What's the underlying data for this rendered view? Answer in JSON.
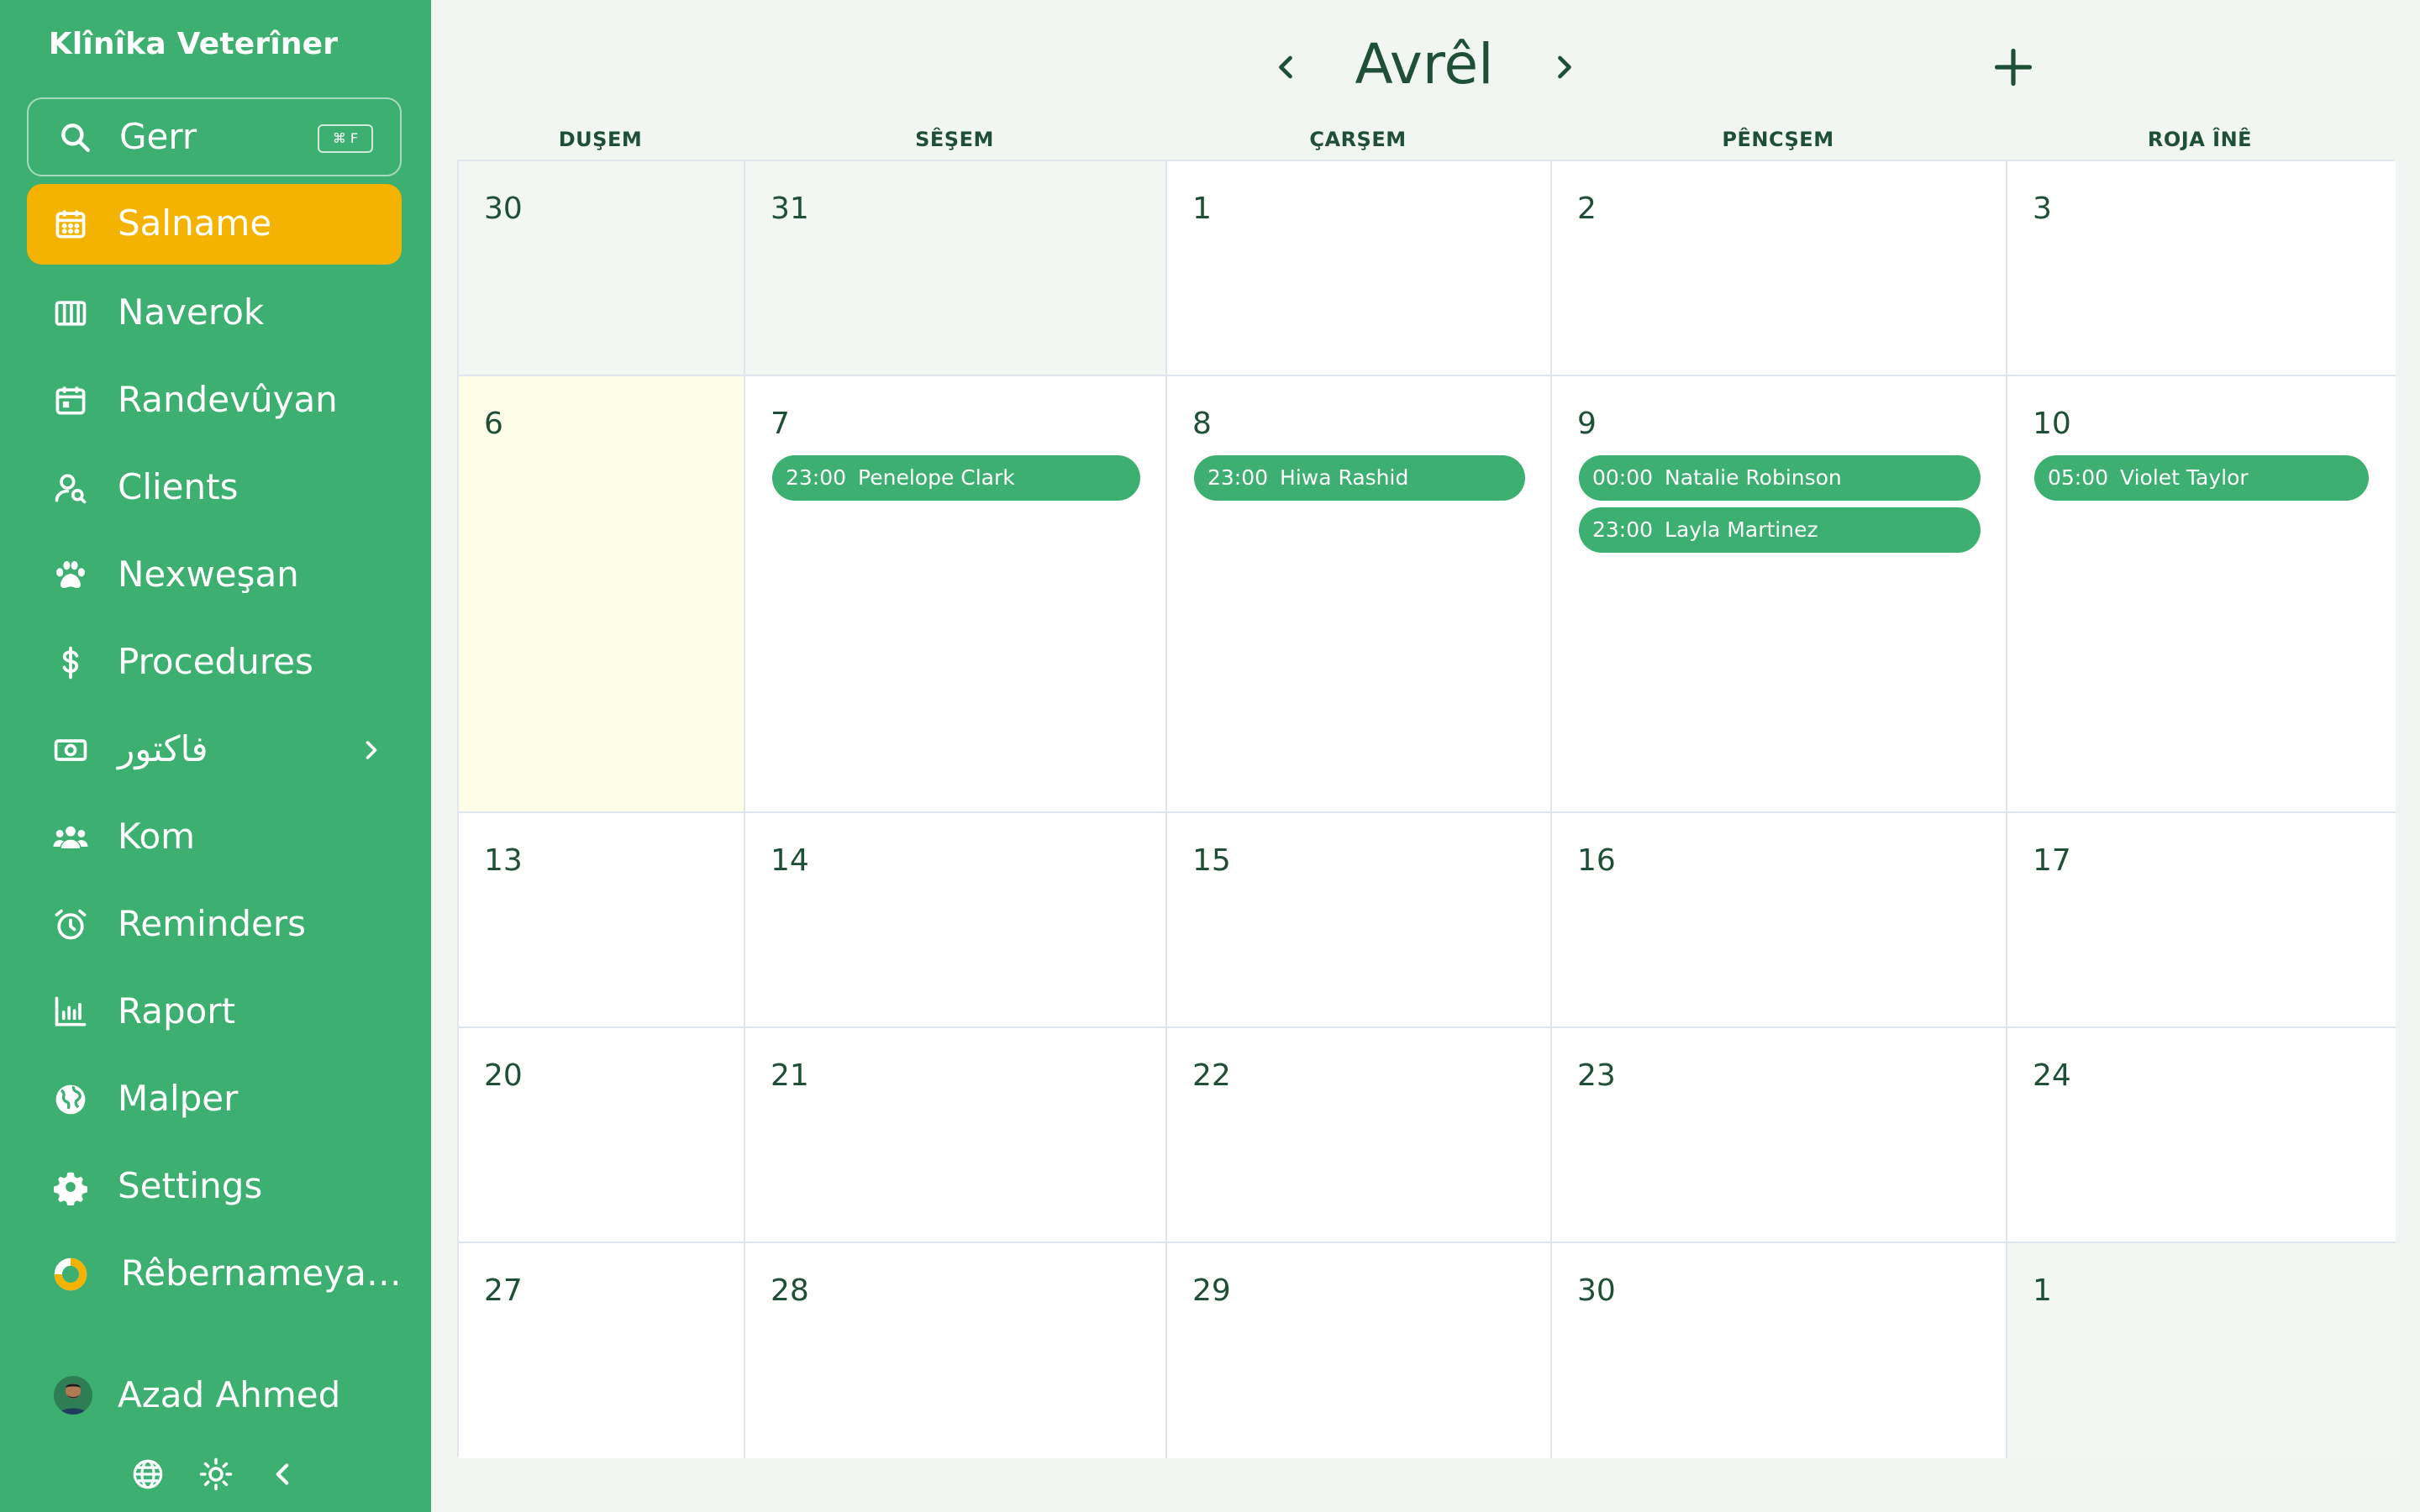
{
  "app": {
    "title": "Klînîka Veterîner"
  },
  "search": {
    "label": "Gerr",
    "shortcut": "⌘ F"
  },
  "nav": [
    {
      "label": "Salname",
      "icon": "calendar-icon",
      "active": true
    },
    {
      "label": "Naverok",
      "icon": "columns-icon"
    },
    {
      "label": "Randevûyan",
      "icon": "calendar-event-icon"
    },
    {
      "label": "Clients",
      "icon": "user-search-icon"
    },
    {
      "label": "Nexweşan",
      "icon": "paw-icon"
    },
    {
      "label": "Procedures",
      "icon": "dollar-icon"
    },
    {
      "label": "فاکتور",
      "icon": "cash-icon",
      "has_submenu": true
    },
    {
      "label": "Kom",
      "icon": "users-icon"
    },
    {
      "label": "Reminders",
      "icon": "alarm-icon"
    },
    {
      "label": "Raport",
      "icon": "bar-chart-icon"
    },
    {
      "label": "Malper",
      "icon": "globe-icon"
    },
    {
      "label": "Settings",
      "icon": "gear-icon"
    },
    {
      "label": "Rêbernameya…",
      "icon": "progress-ring-icon"
    }
  ],
  "user": {
    "name": "Azad Ahmed"
  },
  "calendar": {
    "month": "Avrêl",
    "weekdays": [
      "DUŞEM",
      "SÊŞEM",
      "ÇARŞEM",
      "PÊNCŞEM",
      "ROJA ÎNÊ"
    ],
    "weeks": [
      [
        {
          "day": "30",
          "muted": true,
          "events": []
        },
        {
          "day": "31",
          "muted": true,
          "events": []
        },
        {
          "day": "1",
          "events": []
        },
        {
          "day": "2",
          "events": []
        },
        {
          "day": "3",
          "events": []
        }
      ],
      [
        {
          "day": "6",
          "today": true,
          "events": []
        },
        {
          "day": "7",
          "events": [
            {
              "time": "23:00",
              "name": "Penelope Clark"
            }
          ]
        },
        {
          "day": "8",
          "events": [
            {
              "time": "23:00",
              "name": "Hiwa Rashid"
            }
          ]
        },
        {
          "day": "9",
          "events": [
            {
              "time": "00:00",
              "name": "Natalie Robinson"
            },
            {
              "time": "23:00",
              "name": "Layla Martinez"
            }
          ]
        },
        {
          "day": "10",
          "events": [
            {
              "time": "05:00",
              "name": "Violet Taylor"
            }
          ]
        }
      ],
      [
        {
          "day": "13",
          "events": []
        },
        {
          "day": "14",
          "events": []
        },
        {
          "day": "15",
          "events": []
        },
        {
          "day": "16",
          "events": []
        },
        {
          "day": "17",
          "events": []
        }
      ],
      [
        {
          "day": "20",
          "events": []
        },
        {
          "day": "21",
          "events": []
        },
        {
          "day": "22",
          "events": []
        },
        {
          "day": "23",
          "events": []
        },
        {
          "day": "24",
          "events": []
        }
      ],
      [
        {
          "day": "27",
          "events": []
        },
        {
          "day": "28",
          "events": []
        },
        {
          "day": "29",
          "events": []
        },
        {
          "day": "30",
          "events": []
        },
        {
          "day": "1",
          "muted": true,
          "events": []
        }
      ]
    ]
  },
  "colors": {
    "sidebar": "#3daf70",
    "active": "#f5b301",
    "event": "#3daf70",
    "today": "#fefee8",
    "text": "#1f4f37"
  }
}
